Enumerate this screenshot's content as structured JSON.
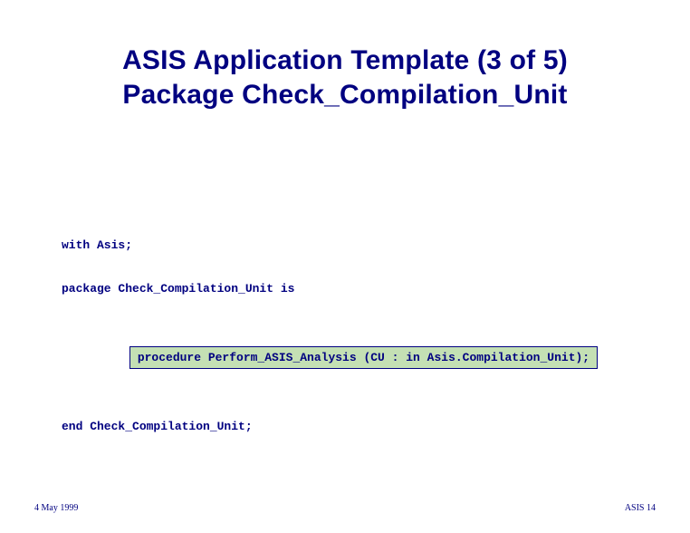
{
  "title": {
    "line1": "ASIS Application Template (3 of 5)",
    "line2": "Package Check_Compilation_Unit"
  },
  "code": {
    "line1": "with Asis;",
    "line2": "package Check_Compilation_Unit is",
    "boxed": "procedure Perform_ASIS_Analysis (CU : in Asis.Compilation_Unit);",
    "line3": "end Check_Compilation_Unit;"
  },
  "footer": {
    "left": "4 May 1999",
    "right": "ASIS 14"
  }
}
